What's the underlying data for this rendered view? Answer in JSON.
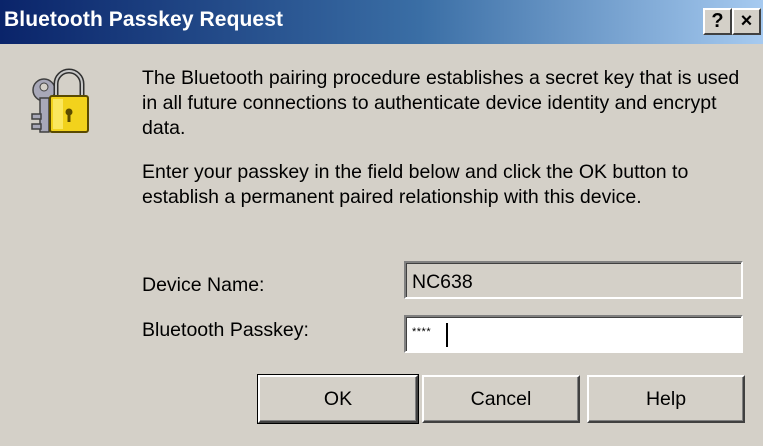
{
  "window": {
    "title": "Bluetooth Passkey Request",
    "help_button": "?",
    "close_button": "×"
  },
  "icon": "keys-padlock-icon",
  "message": {
    "paragraph1": "The Bluetooth pairing procedure establishes a secret key that is used in all future connections to authenticate device identity and encrypt data.",
    "paragraph2": "Enter your passkey in the field below and click the OK button to establish a permanent paired relationship with this device."
  },
  "form": {
    "device_name_label": "Device Name:",
    "device_name_value": "NC638",
    "passkey_label": "Bluetooth Passkey:",
    "passkey_value": "****"
  },
  "buttons": {
    "ok": "OK",
    "cancel": "Cancel",
    "help": "Help"
  }
}
